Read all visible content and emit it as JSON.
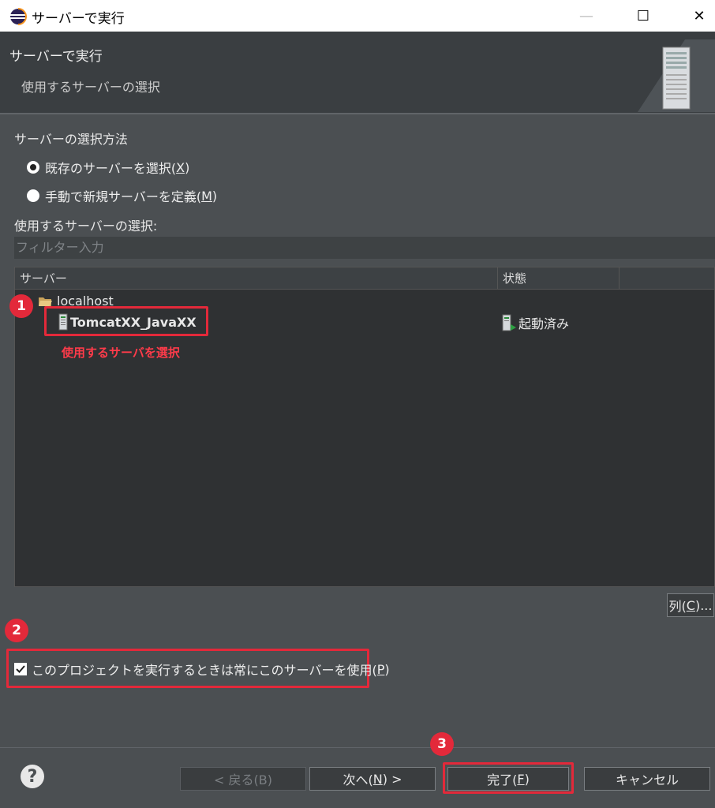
{
  "window": {
    "title": "サーバーで実行",
    "controls": {
      "minimize": "—",
      "maximize": "☐",
      "close": "✕"
    }
  },
  "header": {
    "title": "サーバーで実行",
    "subtitle": "使用するサーバーの選択"
  },
  "selection_method": {
    "label": "サーバーの選択方法",
    "options": [
      {
        "label": "既存のサーバーを選択(",
        "mnemonic": "X",
        "suffix": ")",
        "checked": true
      },
      {
        "label": "手動で新規サーバーを定義(",
        "mnemonic": "M",
        "suffix": ")",
        "checked": false
      }
    ]
  },
  "server_list": {
    "label": "使用するサーバーの選択:",
    "filter_placeholder": "フィルター入力",
    "columns": [
      "サーバー",
      "状態"
    ],
    "tree": {
      "group": "localhost",
      "items": [
        {
          "name": "TomcatXX_JavaXX",
          "status": "起動済み"
        }
      ]
    }
  },
  "annotations": {
    "badges": [
      "1",
      "2",
      "3"
    ],
    "note": "使用するサーバを選択",
    "color": "#e3293a"
  },
  "columns_button": {
    "label": "列(",
    "mnemonic": "C",
    "suffix": ")..."
  },
  "always_use": {
    "checked": true,
    "label": "このプロジェクトを実行するときは常にこのサーバーを使用(",
    "mnemonic": "P",
    "suffix": ")"
  },
  "footer": {
    "help_icon": "?",
    "back": "< 戻る(B)",
    "next": {
      "label": "次へ(",
      "mnemonic": "N",
      "suffix": ") >"
    },
    "finish": {
      "label": "完了(",
      "mnemonic": "F",
      "suffix": ")"
    },
    "cancel": "キャンセル"
  }
}
